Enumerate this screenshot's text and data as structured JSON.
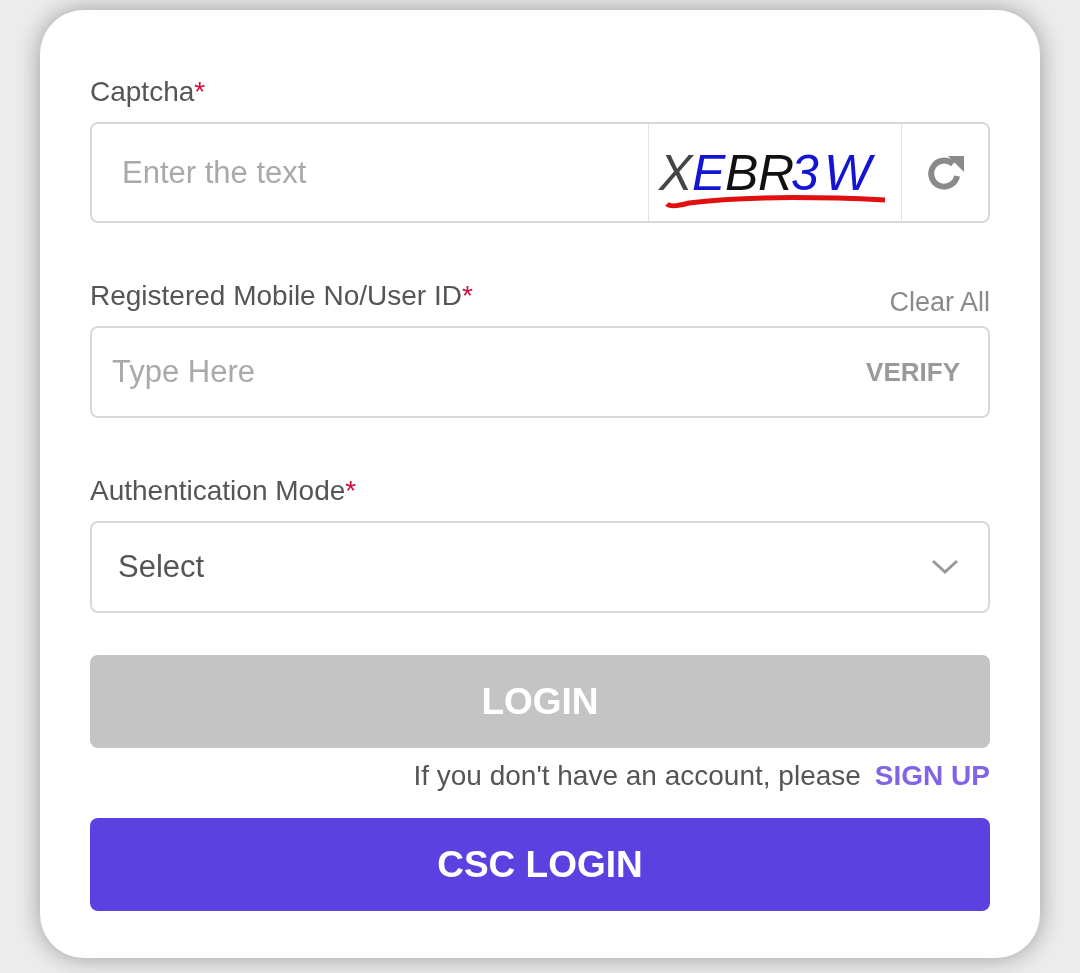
{
  "captcha": {
    "label": "Captcha",
    "required_mark": "*",
    "placeholder": "Enter the text",
    "characters": [
      {
        "char": "X",
        "color": "#454545"
      },
      {
        "char": "E",
        "color": "#1414d2"
      },
      {
        "char": "B",
        "color": "#111111"
      },
      {
        "char": "R",
        "color": "#111111"
      },
      {
        "char": "3",
        "color": "#1414d2"
      },
      {
        "char": "W",
        "color": "#1414d2"
      }
    ]
  },
  "user_id": {
    "label": "Registered Mobile No/User ID",
    "required_mark": "*",
    "clear_label": "Clear All",
    "placeholder": "Type Here",
    "verify_label": "VERIFY"
  },
  "auth_mode": {
    "label": "Authentication Mode",
    "required_mark": "*",
    "value": "Select"
  },
  "login_button": {
    "label": "LOGIN",
    "disabled": true
  },
  "signup": {
    "text": "If you don't have an account, please",
    "link": "SIGN UP"
  },
  "csc_button": {
    "label": "CSC LOGIN",
    "disabled": false
  }
}
